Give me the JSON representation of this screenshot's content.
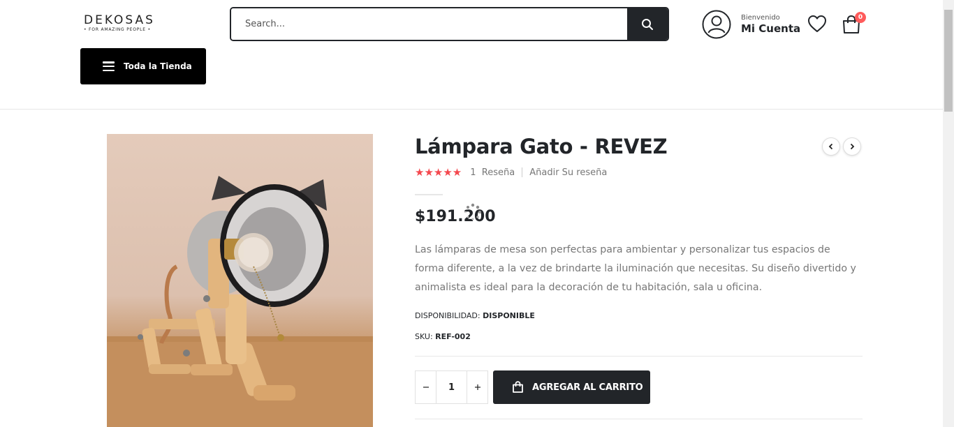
{
  "header": {
    "logo": {
      "name": "DEKOSAS",
      "tagline": "• FOR AMAZING PEOPLE •"
    },
    "search": {
      "placeholder": "Search..."
    },
    "account": {
      "welcome": "Bienvenido",
      "name": "Mi Cuenta"
    },
    "cart": {
      "count": "0"
    },
    "store_button": {
      "label": "Toda la Tienda"
    }
  },
  "product": {
    "title": "Lámpara Gato - REVEZ",
    "rating": {
      "stars": 5,
      "review_count": "1",
      "reviews_label": "Reseña",
      "add_review": "Añadir Su reseña"
    },
    "price": "$191.200",
    "description": "Las lámparas de mesa son perfectas para ambientar y personalizar tus espacios de forma diferente, a la vez de brindarte la iluminación que necesitas. Su diseño divertido y animalista es ideal para la decoración de tu habitación, sala u oficina.",
    "availability": {
      "label": "DISPONIBILIDAD:",
      "value": "DISPONIBLE"
    },
    "sku": {
      "label": "SKU:",
      "value": "REF-002"
    },
    "quantity": "1",
    "add_to_cart": "AGREGAR AL CARRITO"
  },
  "colors": {
    "dark": "#222529",
    "star": "#f4484e",
    "badge": "#ff5b5b",
    "text_muted": "#777777"
  },
  "icons": [
    "search-icon",
    "user-icon",
    "heart-icon",
    "shopping-bag-icon",
    "menu-icon",
    "chevron-left-icon",
    "chevron-right-icon",
    "star-icon",
    "minus-icon",
    "plus-icon",
    "loading-spinner-icon"
  ]
}
